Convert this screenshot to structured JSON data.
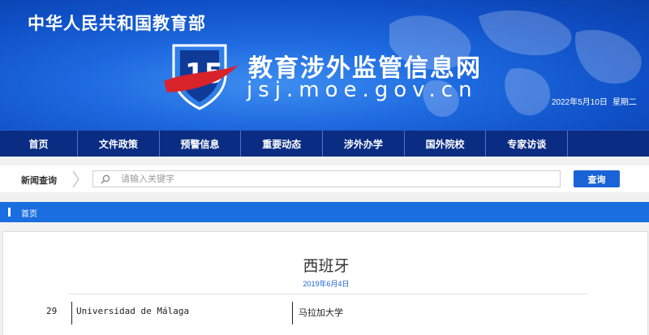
{
  "header": {
    "gov_title": "中华人民共和国教育部",
    "site_name_cn": "教育涉外监管信息网",
    "site_name_en": "jsj.moe.gov.cn",
    "date": "2022年5月10日",
    "weekday": "星期二",
    "colors": {
      "banner": "#1e6ae0",
      "nav": "#0a2d83",
      "accent_red": "#d8232a"
    }
  },
  "nav": {
    "items": [
      "首页",
      "文件政策",
      "预警信息",
      "重要动态",
      "涉外办学",
      "国外院校",
      "专家访谈"
    ]
  },
  "search": {
    "label": "新闻查询",
    "placeholder": "请输入关键字",
    "button_label": "查询"
  },
  "breadcrumb": {
    "home": "首页"
  },
  "article": {
    "title": "西班牙",
    "date": "2019年6月4日",
    "rows": [
      {
        "num": "29",
        "name": "Universidad de Málaga",
        "name_cn": "马拉加大学"
      }
    ]
  }
}
